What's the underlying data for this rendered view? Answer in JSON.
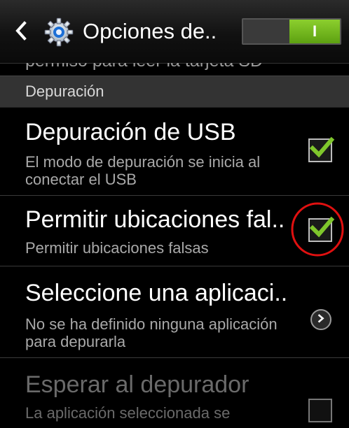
{
  "header": {
    "title": "Opciones de..",
    "toggle_label": "I",
    "back_icon": "back-arrow-icon",
    "app_icon": "gear-icon",
    "accent": "#76b82a"
  },
  "clipped_row_text": "permiso para leer la tarjeta SD",
  "section": {
    "label": "Depuración"
  },
  "rows": [
    {
      "title": "Depuración de USB",
      "subtitle": "El modo de depuración se inicia al conectar el USB",
      "control": "checkbox",
      "checked": true
    },
    {
      "title": "Permitir ubicaciones fal..",
      "subtitle": "Permitir ubicaciones falsas",
      "control": "checkbox",
      "checked": true
    },
    {
      "title": "Seleccione una aplicaci..",
      "subtitle": "No se ha definido ninguna aplicación para depurarla",
      "control": "chevron-right-icon"
    },
    {
      "title": "Esperar al depurador",
      "subtitle": "La aplicación seleccionada se",
      "control": "checkbox",
      "checked": false,
      "disabled": true
    }
  ],
  "annotation_color": "#e01010"
}
